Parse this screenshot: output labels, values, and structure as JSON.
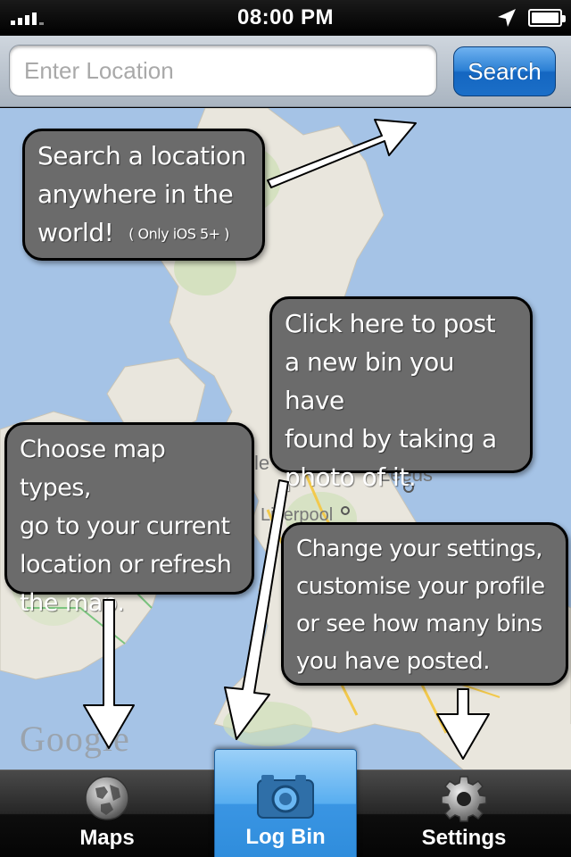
{
  "status_bar": {
    "time": "08:00 PM"
  },
  "search": {
    "placeholder": "Enter Location",
    "button_label": "Search"
  },
  "map": {
    "labels": {
      "leeds": "Leeds",
      "liverpool": "Liverpool",
      "ble": "le"
    },
    "logo": "Google"
  },
  "callouts": {
    "search_lines": [
      "Search a location",
      "anywhere in the",
      "world!"
    ],
    "search_note": "( Only iOS 5+ )",
    "post_lines": [
      "Click here to post",
      "a new bin you have",
      "found by taking a",
      "photo of it."
    ],
    "maps_lines": [
      "Choose map types,",
      "go to your current",
      "location or refresh",
      "the map."
    ],
    "settings_lines": [
      "Change your settings,",
      "customise your profile",
      "or see how many bins",
      "you have posted."
    ]
  },
  "tabs": {
    "maps": {
      "label": "Maps",
      "icon": "globe-icon"
    },
    "log": {
      "label": "Log Bin",
      "icon": "camera-icon"
    },
    "settings": {
      "label": "Settings",
      "icon": "gear-icon"
    }
  },
  "colors": {
    "accent": "#2b7fd4",
    "callout_bg": "#6b6b6b",
    "sea": "#a5c3e6",
    "land": "#e9e6dd"
  }
}
